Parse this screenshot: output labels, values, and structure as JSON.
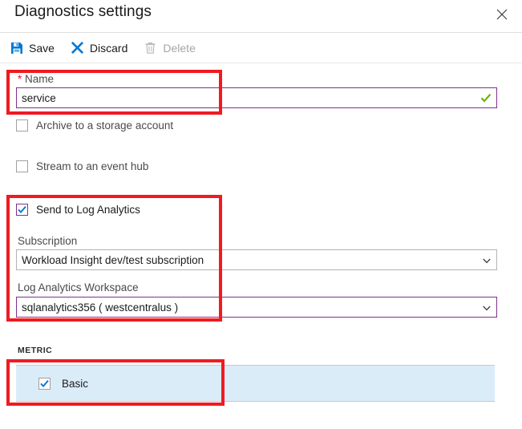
{
  "window": {
    "title": "Diagnostics settings",
    "close_icon": "close-icon"
  },
  "toolbar": {
    "commands": [
      {
        "label": "Save",
        "icon": "save-floppy-icon",
        "enabled": true,
        "color": "#0078d4"
      },
      {
        "label": "Discard",
        "icon": "discard-x-icon",
        "enabled": true,
        "color": "#0078d4"
      },
      {
        "label": "Delete",
        "icon": "delete-trash-icon",
        "enabled": false,
        "color": "#a6a6a6"
      }
    ]
  },
  "form": {
    "name_field": {
      "label": "Name",
      "required_marker": "*",
      "value": "service",
      "placeholder": "Name",
      "validation_icon": "green-check-icon",
      "validation_color": "#6bb700",
      "focus_border_color": "#812f8e"
    },
    "archive_checkbox": {
      "label": "Archive to a storage account",
      "checked": false
    },
    "eventhub_checkbox": {
      "label": "Stream to an event hub",
      "checked": false
    },
    "log_analytics_checkbox": {
      "label": "Send to Log Analytics",
      "checked": true,
      "check_color": "#0078d4",
      "border_color": "#812f8e"
    },
    "subscription": {
      "label": "Subscription",
      "value": "Workload Insight dev/test subscription",
      "chevron_icon": "chevron-down-icon",
      "border_color": "#b3b3b3"
    },
    "workspace": {
      "label": "Log Analytics Workspace",
      "value": "sqlanalytics356 ( westcentralus )",
      "chevron_icon": "chevron-down-icon",
      "border_color": "#812f8e"
    },
    "metric_section": {
      "header": "METRIC",
      "rows": [
        {
          "label": "Basic",
          "checked": true,
          "highlight_color": "#dbecf9"
        }
      ]
    }
  },
  "annotations": {
    "highlight_color": "#f01a21",
    "boxes": [
      {
        "name": "name-field-annotation"
      },
      {
        "name": "log-analytics-annotation"
      },
      {
        "name": "metric-basic-annotation"
      }
    ]
  }
}
